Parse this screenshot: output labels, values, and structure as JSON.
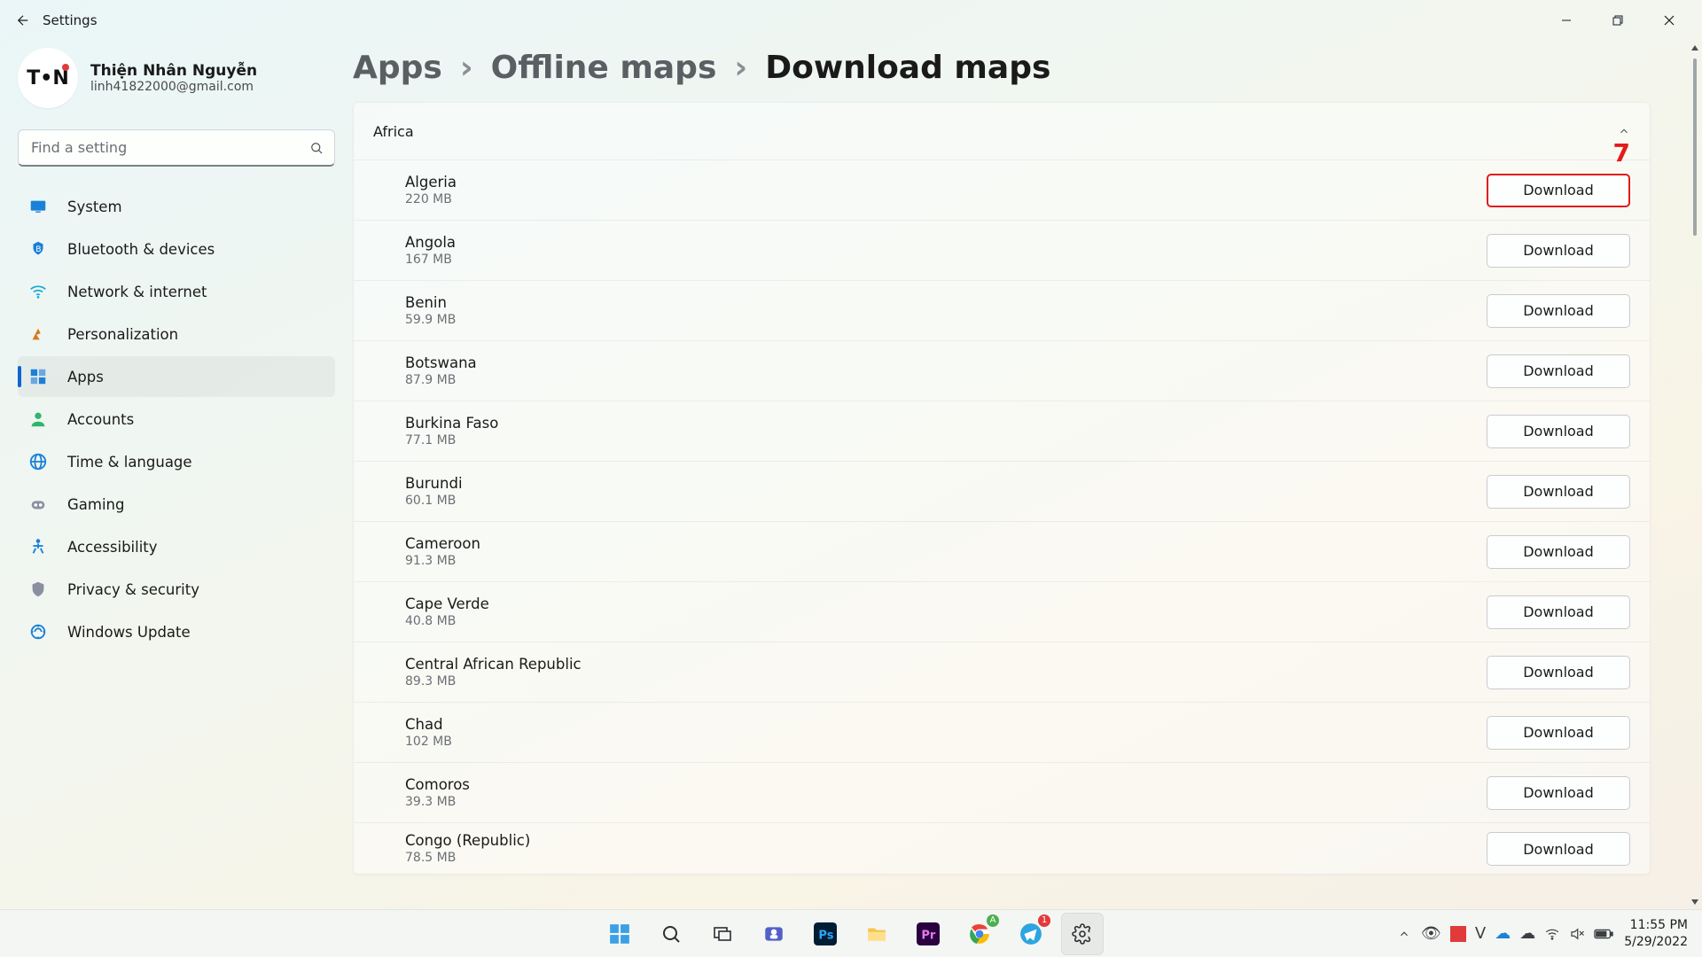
{
  "titlebar": {
    "app_name": "Settings"
  },
  "user": {
    "name": "Thiện Nhân Nguyễn",
    "email": "linh41822000@gmail.com",
    "avatar_text": "T•N"
  },
  "search": {
    "placeholder": "Find a setting"
  },
  "nav": {
    "items": [
      {
        "label": "System"
      },
      {
        "label": "Bluetooth & devices"
      },
      {
        "label": "Network & internet"
      },
      {
        "label": "Personalization"
      },
      {
        "label": "Apps",
        "active": true
      },
      {
        "label": "Accounts"
      },
      {
        "label": "Time & language"
      },
      {
        "label": "Gaming"
      },
      {
        "label": "Accessibility"
      },
      {
        "label": "Privacy & security"
      },
      {
        "label": "Windows Update"
      }
    ]
  },
  "breadcrumb": {
    "root": "Apps",
    "mid": "Offline maps",
    "leaf": "Download maps",
    "sep": "›"
  },
  "region": {
    "name": "Africa"
  },
  "download_label": "Download",
  "maps": [
    {
      "name": "Algeria",
      "size": "220 MB",
      "highlight": true
    },
    {
      "name": "Angola",
      "size": "167 MB"
    },
    {
      "name": "Benin",
      "size": "59.9 MB"
    },
    {
      "name": "Botswana",
      "size": "87.9 MB"
    },
    {
      "name": "Burkina Faso",
      "size": "77.1 MB"
    },
    {
      "name": "Burundi",
      "size": "60.1 MB"
    },
    {
      "name": "Cameroon",
      "size": "91.3 MB"
    },
    {
      "name": "Cape Verde",
      "size": "40.8 MB"
    },
    {
      "name": "Central African Republic",
      "size": "89.3 MB"
    },
    {
      "name": "Chad",
      "size": "102 MB"
    },
    {
      "name": "Comoros",
      "size": "39.3 MB"
    },
    {
      "name": "Congo (Republic)",
      "size": "78.5 MB"
    }
  ],
  "annotation": {
    "label": "7"
  },
  "clock": {
    "time": "11:55 PM",
    "date": "5/29/2022"
  },
  "nav_icons": {
    "system": "#1a80d8",
    "bluetooth": "#1a80d8",
    "network": "#1aaed8",
    "personalization": "#d87a1a",
    "apps": "#1a80d8",
    "accounts": "#2fb56b",
    "time": "#1a80d8",
    "gaming": "#8a90a0",
    "accessibility": "#1a80d8",
    "privacy": "#8a90a0",
    "update": "#1a80d8"
  }
}
